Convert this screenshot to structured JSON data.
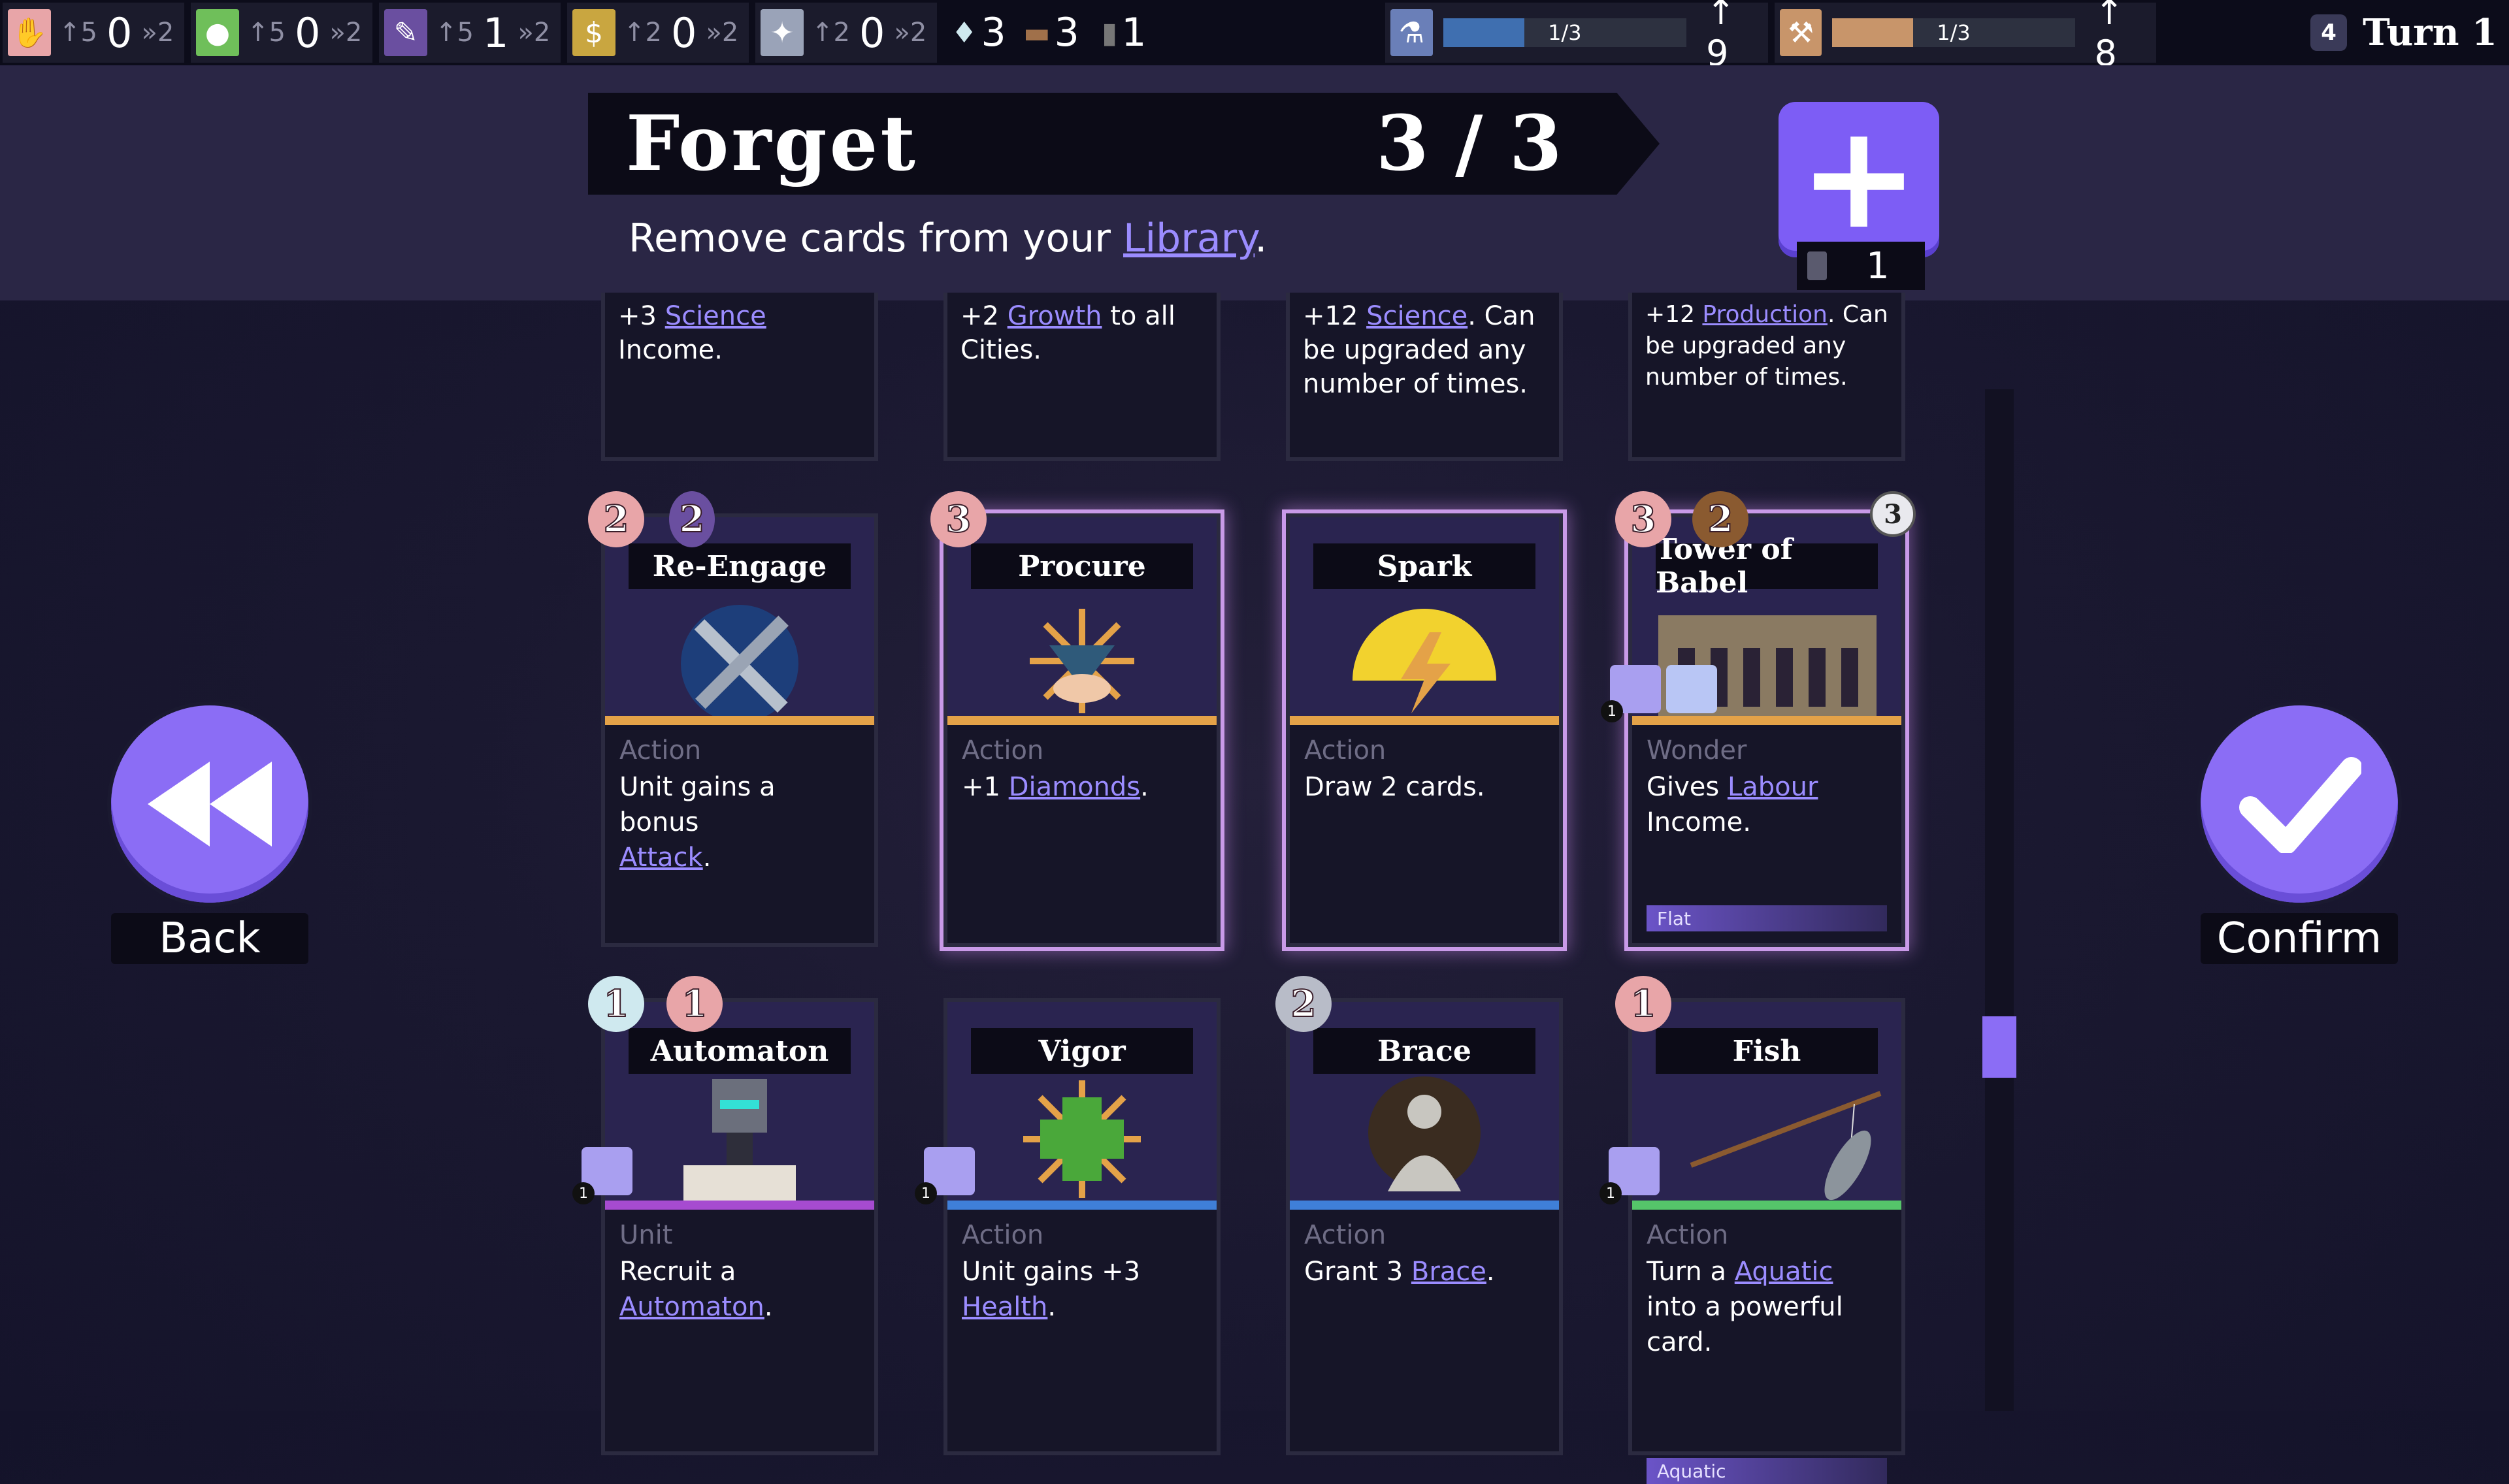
{
  "resources": [
    {
      "icon": "labour-hand-icon",
      "color": "#e8a5a8",
      "rate": "↑5",
      "amount": "0",
      "mult": "»2"
    },
    {
      "icon": "food-apple-icon",
      "color": "#6fbf5a",
      "rate": "↑5",
      "amount": "0",
      "mult": "»2"
    },
    {
      "icon": "feather-icon",
      "color": "#6a4fa0",
      "rate": "↑5",
      "amount": "1",
      "mult": "»2"
    },
    {
      "icon": "gold-bag-icon",
      "color": "#c9a640",
      "rate": "↑2",
      "amount": "0",
      "mult": "»2"
    },
    {
      "icon": "dove-icon",
      "color": "#9aa3b8",
      "rate": "↑2",
      "amount": "0",
      "mult": "»2"
    }
  ],
  "mini_stats": [
    {
      "icon": "diamond-icon",
      "value": "3"
    },
    {
      "icon": "log-icon",
      "value": "3"
    },
    {
      "icon": "card-icon",
      "value": "1"
    }
  ],
  "science": {
    "icon": "flask-icon",
    "progress_label": "1/3",
    "progress": 0.333,
    "income": "↑ 9",
    "color": "#3f6fb0"
  },
  "production": {
    "icon": "hammer-icon",
    "progress_label": "1/3",
    "progress": 0.333,
    "income": "↑ 8",
    "color": "#c8956a"
  },
  "turn": {
    "number": "4",
    "label": "Turn 1"
  },
  "header": {
    "title": "Forget",
    "count": "3 / 3",
    "subtitle_prefix": "Remove cards from your ",
    "subtitle_link": "Library",
    "subtitle_suffix": "."
  },
  "add_button": {
    "count": "1"
  },
  "top_row_cards": [
    {
      "pre": "+3 ",
      "link": "Science",
      "post": " Income."
    },
    {
      "pre": "+2 ",
      "link": "Growth",
      "post": " to all Cities."
    },
    {
      "pre": "+12 ",
      "link": "Science",
      "post": ". Can be upgraded any number of times."
    },
    {
      "pre": "+12 ",
      "link": "Production",
      "post": ". Can be upgraded any number of times."
    }
  ],
  "cards": [
    {
      "name": "Re-Engage",
      "type": "Action",
      "desc_pre": "Unit gains a bonus ",
      "desc_link": "Attack",
      "desc_post": ".",
      "stripe": "#e4a248",
      "selected": false,
      "costs": [
        {
          "kind": "hand",
          "v": "2"
        },
        {
          "kind": "feather",
          "v": "2"
        }
      ]
    },
    {
      "name": "Procure",
      "type": "Action",
      "desc_pre": "+1 ",
      "desc_link": "Diamonds",
      "desc_post": ".",
      "stripe": "#e4a248",
      "selected": true,
      "costs": [
        {
          "kind": "hand",
          "v": "3"
        }
      ]
    },
    {
      "name": "Spark",
      "type": "Action",
      "desc_pre": "Draw 2 cards.",
      "desc_link": "",
      "desc_post": "",
      "stripe": "#e4a248",
      "selected": true,
      "costs": []
    },
    {
      "name": "Tower of Babel",
      "type": "Wonder",
      "desc_pre": "Gives ",
      "desc_link": "Labour",
      "desc_post": " Income.",
      "stripe": "#e4a248",
      "selected": true,
      "tag": "Flat",
      "costs": [
        {
          "kind": "hand",
          "v": "3"
        },
        {
          "kind": "log",
          "v": "2"
        }
      ],
      "corner": "3"
    },
    {
      "name": "Automaton",
      "type": "Unit",
      "desc_pre": "Recruit a ",
      "desc_link": "Automaton",
      "desc_post": ".",
      "stripe": "#a64bd0",
      "selected": false,
      "costs": [
        {
          "kind": "diamond",
          "v": "1"
        },
        {
          "kind": "hand",
          "v": "1"
        }
      ]
    },
    {
      "name": "Vigor",
      "type": "Action",
      "desc_pre": "Unit gains +3 ",
      "desc_link": "Health",
      "desc_post": ".",
      "stripe": "#3f7fd8",
      "selected": false,
      "costs": []
    },
    {
      "name": "Brace",
      "type": "Action",
      "desc_pre": "Grant 3 ",
      "desc_link": "Brace",
      "desc_post": ".",
      "stripe": "#3f7fd8",
      "selected": false,
      "costs": [
        {
          "kind": "dove",
          "v": "2"
        }
      ]
    },
    {
      "name": "Fish",
      "type": "Action",
      "desc_pre": "Turn a ",
      "desc_link": "Aquatic",
      "desc_post": " into a powerful card.",
      "stripe": "#55c56a",
      "selected": false,
      "tag": "Aquatic",
      "costs": [
        {
          "kind": "hand",
          "v": "1"
        }
      ]
    }
  ],
  "back_button": {
    "label": "Back"
  },
  "confirm_button": {
    "label": "Confirm"
  }
}
